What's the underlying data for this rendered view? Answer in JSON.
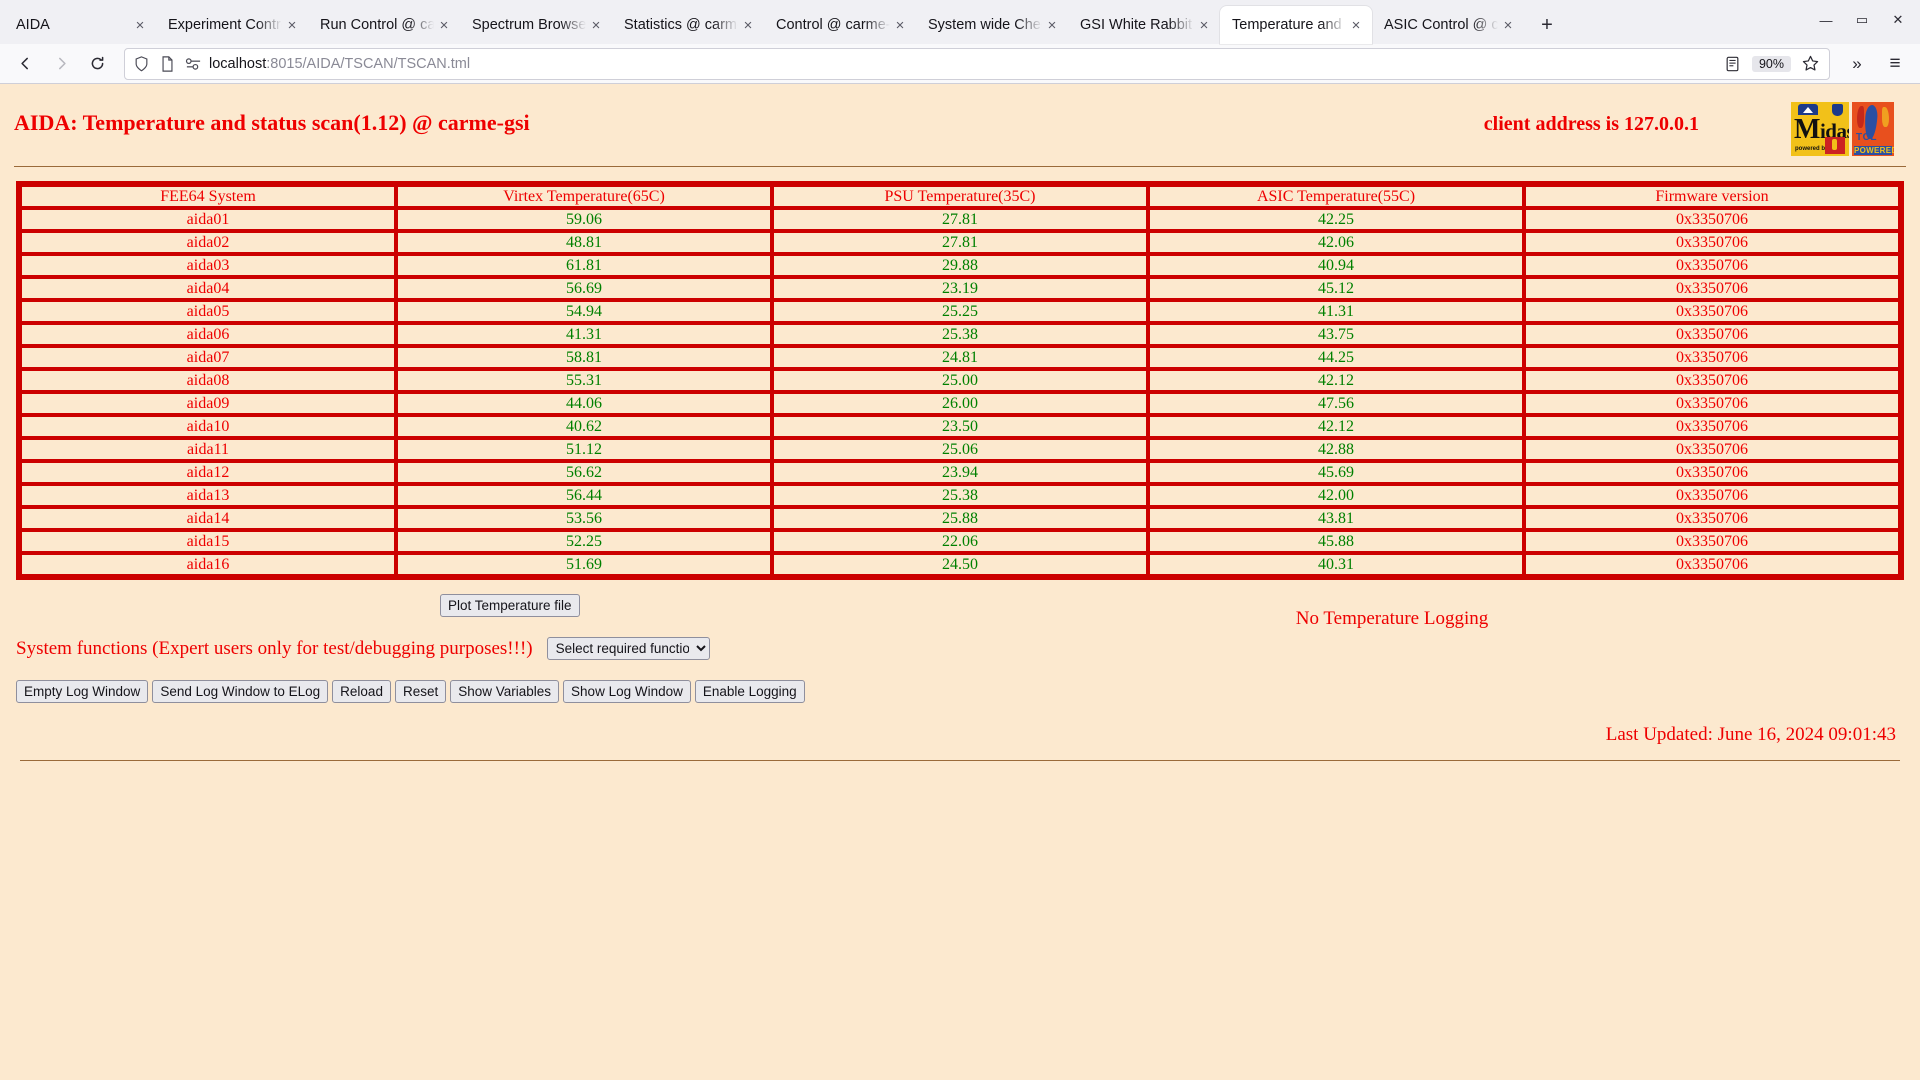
{
  "browser": {
    "tabs": [
      {
        "title": "AIDA",
        "active": false
      },
      {
        "title": "Experiment Control @ carme-gsi",
        "active": false
      },
      {
        "title": "Run Control @ carme-gsi",
        "active": false
      },
      {
        "title": "Spectrum Browser @ carme-gsi",
        "active": false
      },
      {
        "title": "Statistics @ carme-gsi",
        "active": false
      },
      {
        "title": "Control @ carme-gsi",
        "active": false
      },
      {
        "title": "System wide Checks (carme-gsi)",
        "active": false
      },
      {
        "title": "GSI White Rabbit Time",
        "active": false
      },
      {
        "title": "Temperature and status scan",
        "active": true
      },
      {
        "title": "ASIC Control @ carme-gsi",
        "active": false
      }
    ],
    "close_glyph": "×",
    "newtab_glyph": "+",
    "window_minimize": "—",
    "window_maximize": "▭",
    "window_close": "✕",
    "url_prefix": "localhost",
    "url_suffix": ":8015/AIDA/TSCAN/TSCAN.tml",
    "zoom_level": "90%",
    "overflow_glyph": "»",
    "menu_glyph": "≡"
  },
  "page": {
    "title": "AIDA: Temperature and status scan(1.12) @ carme-gsi",
    "client_address": "client address is 127.0.0.1",
    "logo_midas": {
      "word_big": "M",
      "word_rest": "idas",
      "powered_by": "powered by"
    },
    "logo_tcl": {
      "tcl": "TCL",
      "powered": "POWERED"
    },
    "table": {
      "headers": [
        "FEE64 System",
        "Virtex Temperature(65C)",
        "PSU Temperature(35C)",
        "ASIC Temperature(55C)",
        "Firmware version"
      ],
      "rows": [
        {
          "system": "aida01",
          "virtex": "59.06",
          "psu": "27.81",
          "asic": "42.25",
          "firmware": "0x3350706"
        },
        {
          "system": "aida02",
          "virtex": "48.81",
          "psu": "27.81",
          "asic": "42.06",
          "firmware": "0x3350706"
        },
        {
          "system": "aida03",
          "virtex": "61.81",
          "psu": "29.88",
          "asic": "40.94",
          "firmware": "0x3350706"
        },
        {
          "system": "aida04",
          "virtex": "56.69",
          "psu": "23.19",
          "asic": "45.12",
          "firmware": "0x3350706"
        },
        {
          "system": "aida05",
          "virtex": "54.94",
          "psu": "25.25",
          "asic": "41.31",
          "firmware": "0x3350706"
        },
        {
          "system": "aida06",
          "virtex": "41.31",
          "psu": "25.38",
          "asic": "43.75",
          "firmware": "0x3350706"
        },
        {
          "system": "aida07",
          "virtex": "58.81",
          "psu": "24.81",
          "asic": "44.25",
          "firmware": "0x3350706"
        },
        {
          "system": "aida08",
          "virtex": "55.31",
          "psu": "25.00",
          "asic": "42.12",
          "firmware": "0x3350706"
        },
        {
          "system": "aida09",
          "virtex": "44.06",
          "psu": "26.00",
          "asic": "47.56",
          "firmware": "0x3350706"
        },
        {
          "system": "aida10",
          "virtex": "40.62",
          "psu": "23.50",
          "asic": "42.12",
          "firmware": "0x3350706"
        },
        {
          "system": "aida11",
          "virtex": "51.12",
          "psu": "25.06",
          "asic": "42.88",
          "firmware": "0x3350706"
        },
        {
          "system": "aida12",
          "virtex": "56.62",
          "psu": "23.94",
          "asic": "45.69",
          "firmware": "0x3350706"
        },
        {
          "system": "aida13",
          "virtex": "56.44",
          "psu": "25.38",
          "asic": "42.00",
          "firmware": "0x3350706"
        },
        {
          "system": "aida14",
          "virtex": "53.56",
          "psu": "25.88",
          "asic": "43.81",
          "firmware": "0x3350706"
        },
        {
          "system": "aida15",
          "virtex": "52.25",
          "psu": "22.06",
          "asic": "45.88",
          "firmware": "0x3350706"
        },
        {
          "system": "aida16",
          "virtex": "51.69",
          "psu": "24.50",
          "asic": "40.31",
          "firmware": "0x3350706"
        }
      ]
    },
    "plot_button": "Plot Temperature file",
    "logging_status": "No Temperature Logging",
    "system_functions_label": "System functions (Expert users only for test/debugging purposes!!!)",
    "function_select_value": "Select required function",
    "buttons": [
      "Empty Log Window",
      "Send Log Window to ELog",
      "Reload",
      "Reset",
      "Show Variables",
      "Show Log Window",
      "Enable Logging"
    ],
    "last_updated": "Last Updated: June 16, 2024 09:01:43",
    "colors": {
      "background": "#fce9cf",
      "border_red": "#cc0000",
      "text_red": "#ee0000",
      "text_green": "#008000"
    }
  }
}
